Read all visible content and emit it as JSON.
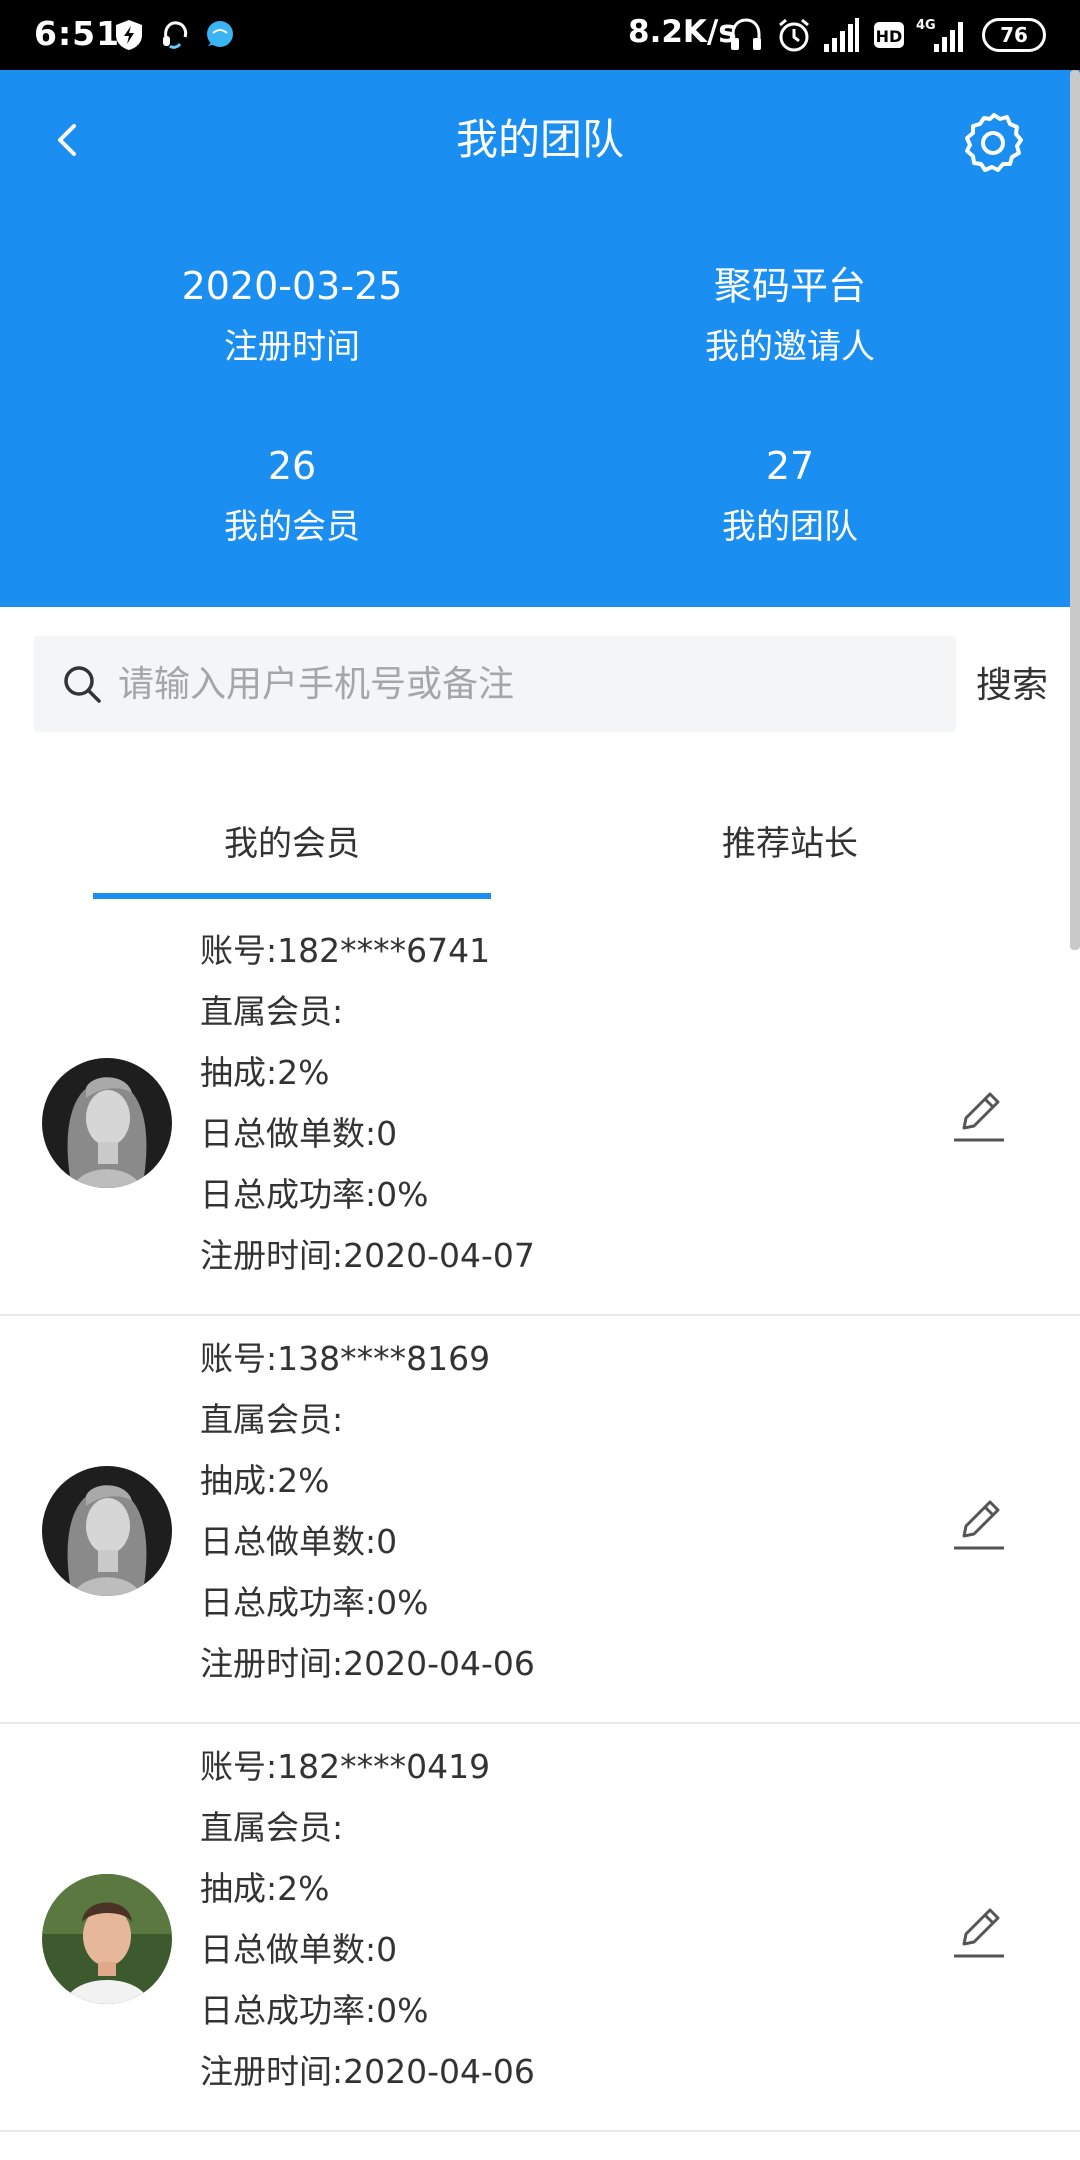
{
  "status_bar": {
    "time": "6:51",
    "speed": "8.2K/s",
    "battery": "76",
    "network": "4G"
  },
  "header": {
    "title": "我的团队",
    "stats": [
      {
        "value": "2020-03-25",
        "label": "注册时间"
      },
      {
        "value": "聚码平台",
        "label": "我的邀请人"
      },
      {
        "value": "26",
        "label": "我的会员"
      },
      {
        "value": "27",
        "label": "我的团队"
      }
    ]
  },
  "search": {
    "placeholder": "请输入用户手机号或备注",
    "button_label": "搜索"
  },
  "tabs": [
    {
      "label": "我的会员",
      "active": true
    },
    {
      "label": "推荐站长",
      "active": false
    }
  ],
  "members": [
    {
      "account": "账号:182****6741",
      "direct": "直属会员:",
      "commission": "抽成:2%",
      "daily_orders": "日总做单数:0",
      "daily_success": "日总成功率:0%",
      "register_time": "注册时间:2020-04-07",
      "avatar": "woman"
    },
    {
      "account": "账号:138****8169",
      "direct": "直属会员:",
      "commission": "抽成:2%",
      "daily_orders": "日总做单数:0",
      "daily_success": "日总成功率:0%",
      "register_time": "注册时间:2020-04-06",
      "avatar": "woman"
    },
    {
      "account": "账号:182****0419",
      "direct": "直属会员:",
      "commission": "抽成:2%",
      "daily_orders": "日总做单数:0",
      "daily_success": "日总成功率:0%",
      "register_time": "注册时间:2020-04-06",
      "avatar": "man"
    }
  ],
  "colors": {
    "primary": "#1a8ef1",
    "text": "#333333",
    "placeholder": "#a6a6a6",
    "search_bg": "#f4f5f7"
  }
}
